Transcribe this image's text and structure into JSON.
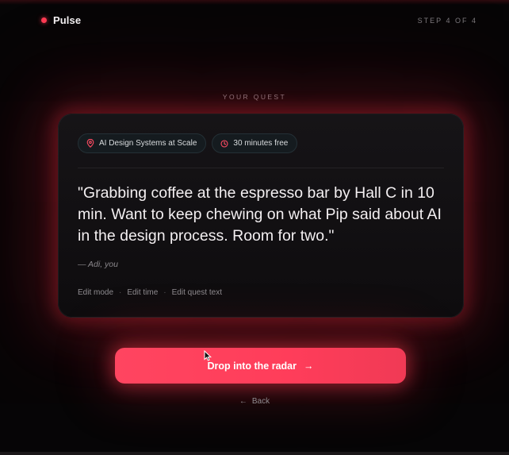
{
  "app": {
    "name": "Pulse",
    "accent": "#ff3b53"
  },
  "header": {
    "step": "STEP 4 OF 4"
  },
  "section": {
    "eyebrow": "YOUR QUEST"
  },
  "card": {
    "chips": [
      {
        "icon": "location-pin-icon",
        "label": "AI Design Systems at Scale"
      },
      {
        "icon": "clock-icon",
        "label": "30 minutes free"
      }
    ],
    "quote": "\"Grabbing coffee at the espresso bar by Hall C in 10 min. Want to keep chewing on what Pip said about AI in the design process. Room for two.\"",
    "attribution": "— Adi, you",
    "edits": {
      "mode": "Edit mode",
      "time": "Edit time",
      "text": "Edit quest text",
      "separator": "·"
    }
  },
  "cta": {
    "label": "Drop into the radar",
    "arrow": "→"
  },
  "back": {
    "label": "Back",
    "arrow": "←"
  }
}
